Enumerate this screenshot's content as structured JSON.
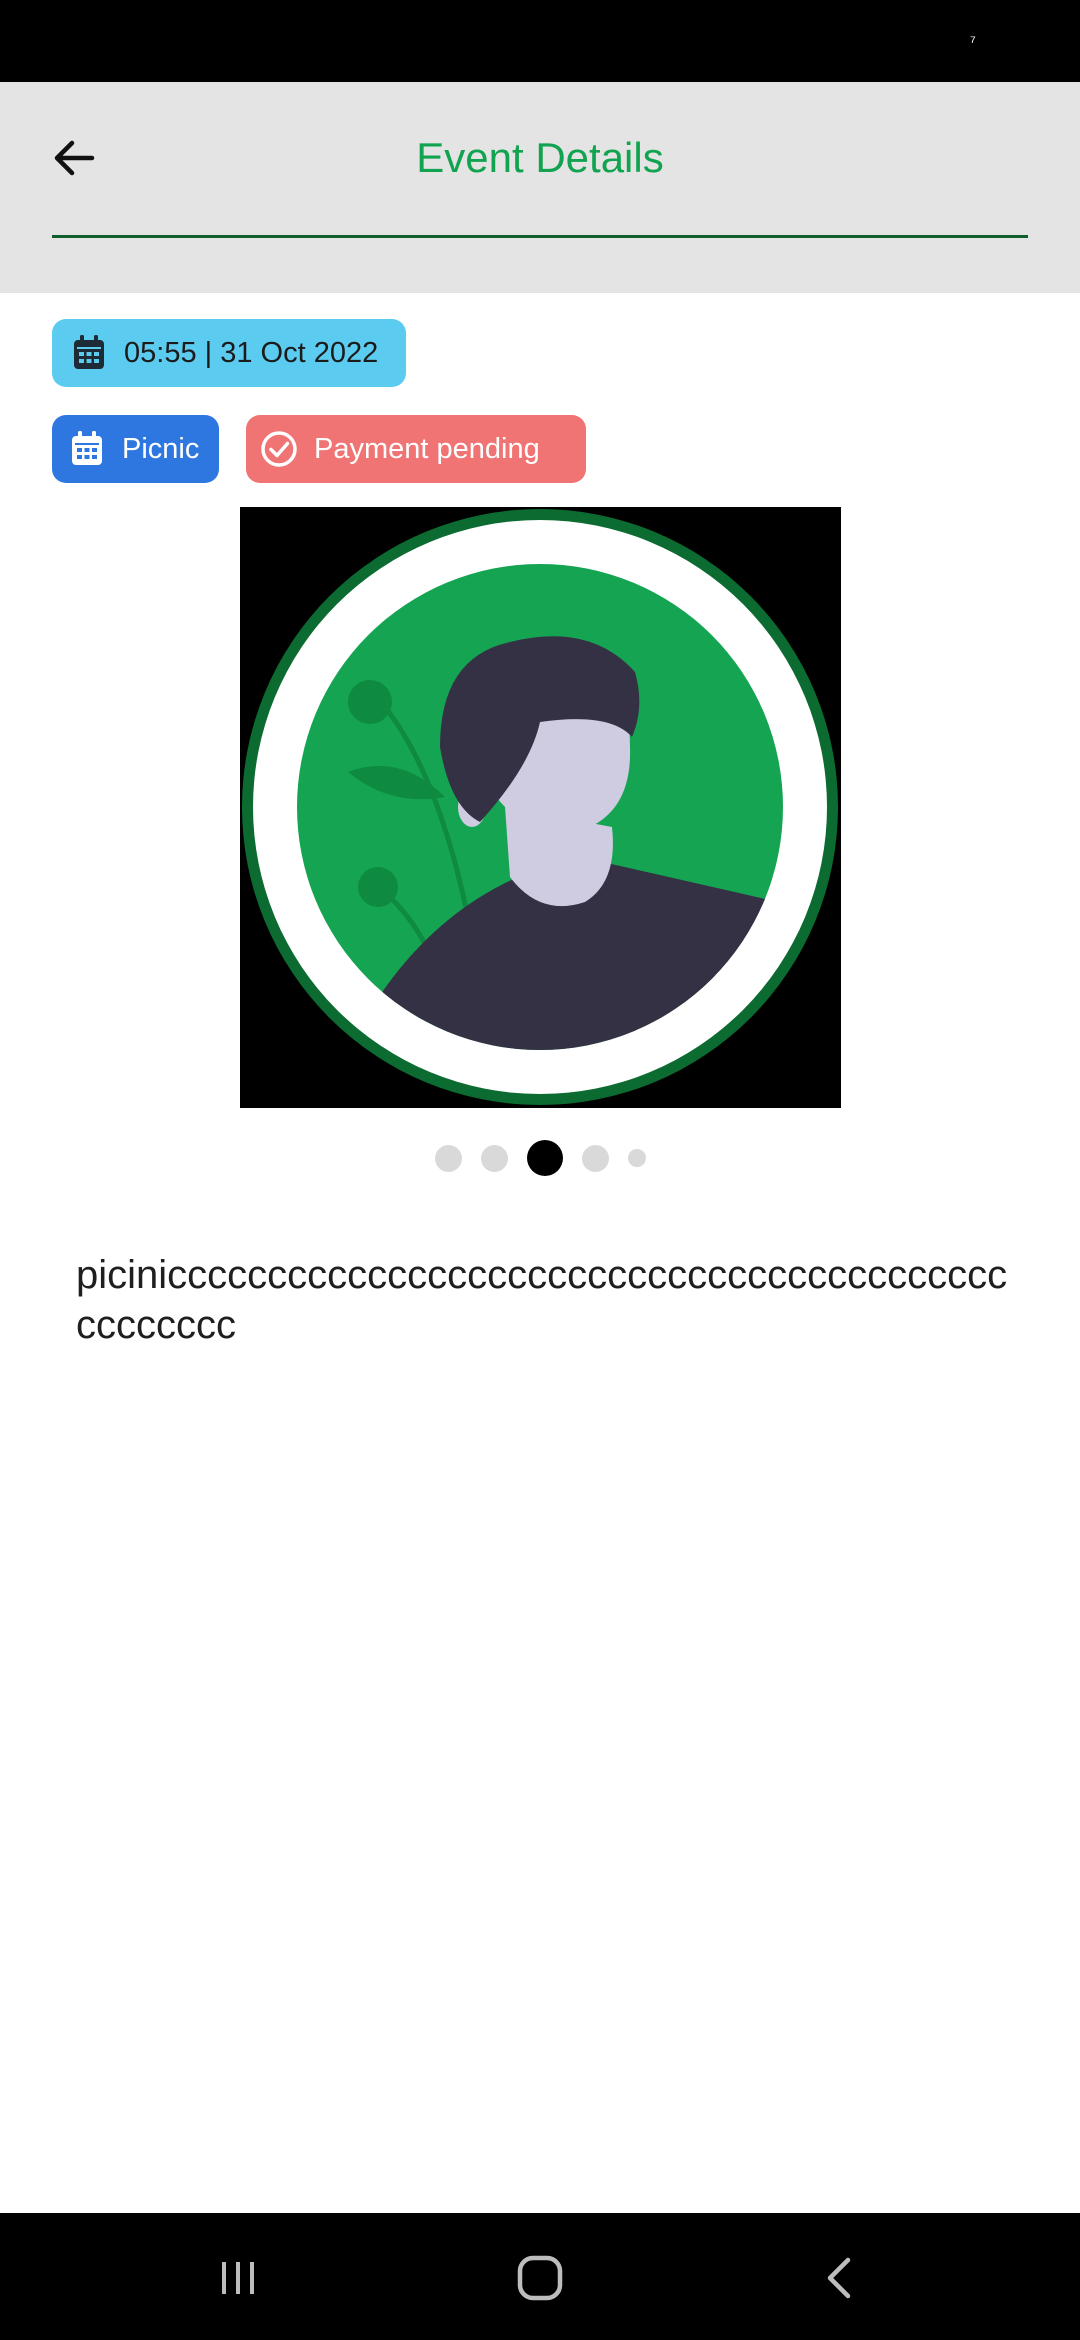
{
  "status_bar": {
    "mark": "⁷"
  },
  "header": {
    "title": "Event Details",
    "back_icon": "arrow-left-icon"
  },
  "event": {
    "datetime": "05:55 | 31 Oct 2022",
    "category": "Picnic",
    "payment_status": "Payment pending",
    "description": "picinicccccccccccccccccccccccccccccccccccccccccccccccccc"
  },
  "carousel": {
    "total": 5,
    "active_index": 2
  },
  "nav_bar": {
    "icons": [
      "recent-apps-icon",
      "home-icon",
      "back-nav-icon"
    ]
  },
  "colors": {
    "accent": "#11a34f",
    "date_chip": "#5bcbf0",
    "category_chip": "#2e77e0",
    "status_chip": "#f07473"
  }
}
